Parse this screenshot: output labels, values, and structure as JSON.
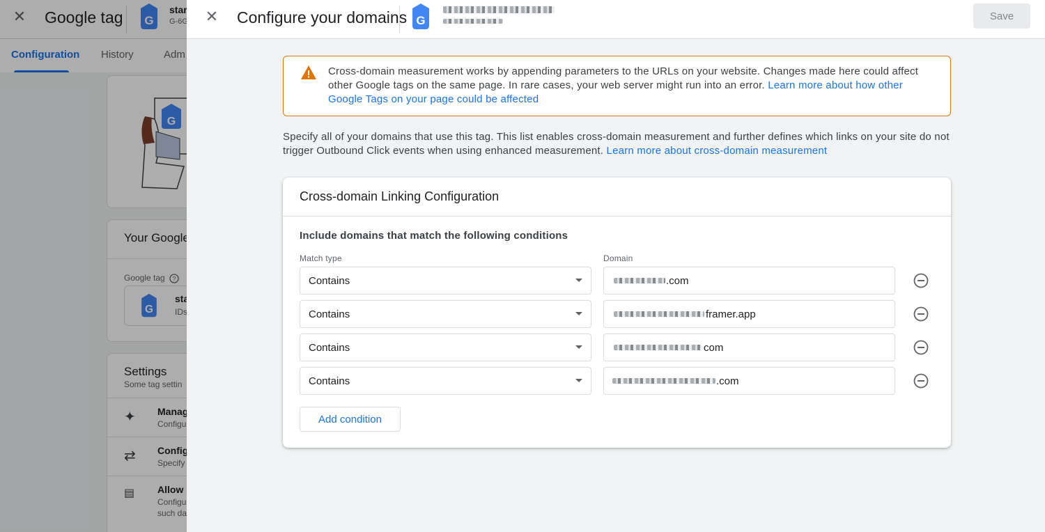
{
  "background": {
    "title": "Google tag",
    "tag_name": "star",
    "tag_id": "G-6G",
    "tabs": [
      {
        "label": "Configuration"
      },
      {
        "label": "History"
      },
      {
        "label": "Adm"
      }
    ],
    "your_tag_card": {
      "title": "Your Google",
      "google_tag_label": "Google tag",
      "tag_name": "sta",
      "tag_ids": "IDs"
    },
    "settings_card": {
      "title": "Settings",
      "subtitle": "Some tag settin",
      "items": [
        {
          "title": "Manag",
          "subtitle": "Configu"
        },
        {
          "title": "Config",
          "subtitle": "Specify"
        },
        {
          "title": "Allow u",
          "subtitle": "Configu",
          "subtitle2": "such da"
        }
      ]
    }
  },
  "sheet": {
    "title": "Configure your domains",
    "save_label": "Save",
    "warning": {
      "text": "Cross-domain measurement works by appending parameters to the URLs on your website. Changes made here could affect other Google tags on the same page. In rare cases, your web server might run into an error.",
      "link": "Learn more about how other Google Tags on your page could be affected"
    },
    "specify": {
      "text": "Specify all of your domains that use this tag. This list enables cross-domain measurement and further defines which links on your site do not trigger Outbound Click events when using enhanced measurement.",
      "link": "Learn more about cross-domain measurement"
    },
    "config": {
      "title": "Cross-domain Linking Configuration",
      "conditions_heading": "Include domains that match the following conditions",
      "match_type_label": "Match type",
      "domain_label": "Domain",
      "rows": [
        {
          "match": "Contains",
          "domain_suffix": ".com"
        },
        {
          "match": "Contains",
          "domain_suffix": "framer.app"
        },
        {
          "match": "Contains",
          "domain_suffix": "com"
        },
        {
          "match": "Contains",
          "domain_suffix": ".com"
        }
      ],
      "add_label": "Add condition"
    }
  },
  "colors": {
    "accent": "#1a73e8",
    "warning": "#e37400",
    "tag_blue": "#4285f4"
  },
  "icons": [
    "close-icon",
    "google-tag-icon",
    "warning-icon",
    "chevron-down-icon",
    "remove-circle-icon",
    "sparkle-icon",
    "compare-arrows-icon",
    "id-card-icon",
    "help-icon"
  ]
}
